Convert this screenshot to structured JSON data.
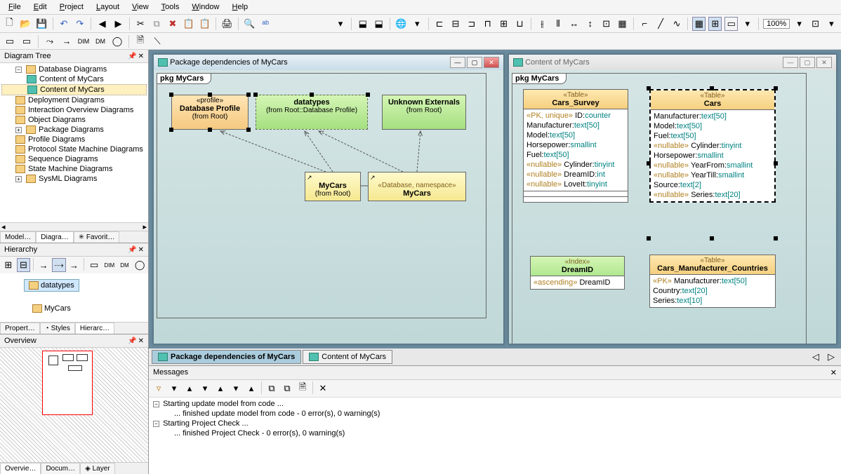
{
  "menu": {
    "file": "File",
    "edit": "Edit",
    "project": "Project",
    "layout": "Layout",
    "view": "View",
    "tools": "Tools",
    "window": "Window",
    "help": "Help"
  },
  "zoom": "100%",
  "panels": {
    "diagram_tree": "Diagram Tree",
    "hierarchy": "Hierarchy",
    "overview": "Overview",
    "messages": "Messages"
  },
  "tree": {
    "root": "Database Diagrams",
    "items": [
      "Content of MyCars",
      "Content of MyCars",
      "Deployment Diagrams",
      "Interaction Overview Diagrams",
      "Object Diagrams",
      "Package Diagrams",
      "Profile Diagrams",
      "Protocol State Machine Diagrams",
      "Sequence Diagrams",
      "State Machine Diagrams",
      "SysML Diagrams"
    ]
  },
  "tree_tabs": {
    "model": "Model…",
    "diagram": "Diagra…",
    "favorites": "Favorit…"
  },
  "hierarchy_nodes": {
    "datatypes": "datatypes",
    "mycars": "MyCars"
  },
  "side_tabs": {
    "properties": "Propert…",
    "styles": "Styles",
    "hierarchy": "Hierarc…"
  },
  "bottom_tabs": {
    "overview": "Overvie…",
    "docum": "Docum…",
    "layer": "Layer"
  },
  "doc1": {
    "title": "Package dependencies of MyCars",
    "pkg_label": "pkg MyCars",
    "boxes": {
      "profile": {
        "stereo": "«profile»",
        "name": "Database Profile",
        "from": "(from Root)"
      },
      "datatypes": {
        "name": "datatypes",
        "from": "(from Root::Database Profile)"
      },
      "unknown": {
        "name": "Unknown Externals",
        "from": "(from Root)"
      },
      "mycars1": {
        "name": "MyCars",
        "from": "(from Root)"
      },
      "mycars2": {
        "stereo": "«Database, namespace»",
        "name": "MyCars"
      }
    }
  },
  "doc2": {
    "title": "Content of MyCars",
    "pkg_label": "pkg MyCars",
    "tables": {
      "cars_survey": {
        "stereo": "«Table»",
        "name": "Cars_Survey",
        "rows": [
          {
            "kw": "«PK, unique»",
            "f": "ID",
            "t": "counter"
          },
          {
            "kw": "",
            "f": "Manufacturer",
            "t": "text[50]"
          },
          {
            "kw": "",
            "f": "Model",
            "t": "text[50]"
          },
          {
            "kw": "",
            "f": "Horsepower",
            "t": "smallint"
          },
          {
            "kw": "",
            "f": "Fuel",
            "t": "text[50]"
          },
          {
            "kw": "«nullable»",
            "f": "Cylinder",
            "t": "tinyint"
          },
          {
            "kw": "«nullable»",
            "f": "DreamID",
            "t": "int"
          },
          {
            "kw": "«nullable»",
            "f": "LoveIt",
            "t": "tinyint"
          }
        ]
      },
      "cars": {
        "stereo": "«Table»",
        "name": "Cars",
        "rows": [
          {
            "kw": "",
            "f": "Manufacturer",
            "t": "text[50]"
          },
          {
            "kw": "",
            "f": "Model",
            "t": "text[50]"
          },
          {
            "kw": "",
            "f": "Fuel",
            "t": "text[50]"
          },
          {
            "kw": "«nullable»",
            "f": "Cylinder",
            "t": "tinyint"
          },
          {
            "kw": "",
            "f": "Horsepower",
            "t": "smallint"
          },
          {
            "kw": "«nullable»",
            "f": "YearFrom",
            "t": "smallint"
          },
          {
            "kw": "«nullable»",
            "f": "YearTill",
            "t": "smallint"
          },
          {
            "kw": "",
            "f": "Source",
            "t": "text[2]"
          },
          {
            "kw": "«nullable»",
            "f": "Series",
            "t": "text[20]"
          }
        ]
      },
      "dreamid": {
        "stereo": "«Index»",
        "name": "DreamID",
        "rows": [
          {
            "kw": "«ascending»",
            "f": "DreamID",
            "t": ""
          }
        ]
      },
      "cmc": {
        "stereo": "«Table»",
        "name": "Cars_Manufacturer_Countries",
        "rows": [
          {
            "kw": "«PK»",
            "f": "Manufacturer",
            "t": "text[50]"
          },
          {
            "kw": "",
            "f": "Country",
            "t": "text[20]"
          },
          {
            "kw": "",
            "f": "Series",
            "t": "text[10]"
          }
        ]
      }
    }
  },
  "doc_tabs": {
    "tab1": "Package dependencies of MyCars",
    "tab2": "Content of MyCars"
  },
  "messages": {
    "lines": [
      "Starting update model from code ...",
      "... finished update model from code - 0 error(s), 0 warning(s)",
      "Starting Project Check ...",
      "... finished Project Check - 0 error(s), 0 warning(s)"
    ]
  }
}
